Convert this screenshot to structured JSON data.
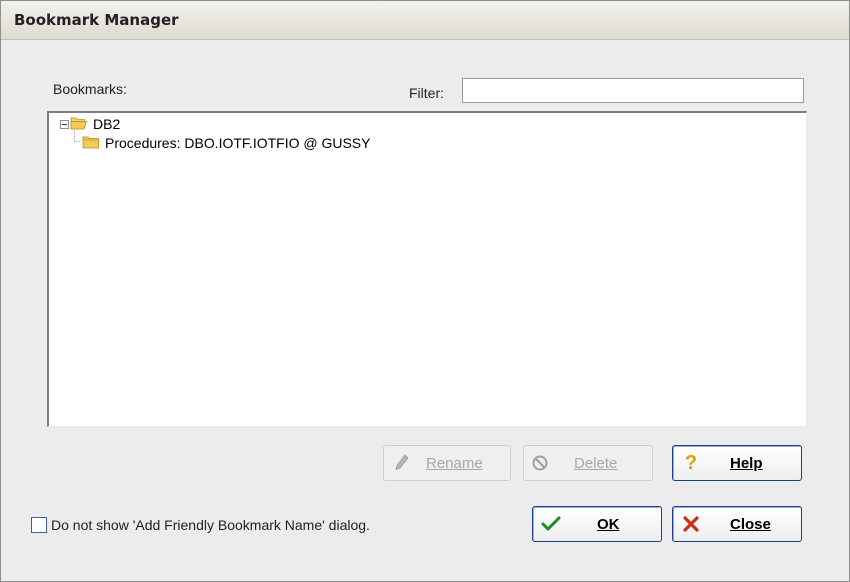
{
  "dialog": {
    "title": "Bookmark Manager"
  },
  "bookmarks_label": "Bookmarks:",
  "filter": {
    "label": "Filter:",
    "value": "",
    "placeholder": ""
  },
  "tree": {
    "root": {
      "label": "DB2",
      "icon": "open-folder-icon",
      "expanded": true
    },
    "children": [
      {
        "label": "Procedures: DBO.IOTF.IOTFIO @ GUSSY",
        "icon": "folder-icon"
      }
    ]
  },
  "buttons": {
    "rename": {
      "label": "Rename",
      "icon": "pencil-icon",
      "enabled": false
    },
    "delete": {
      "label": "Delete",
      "icon": "no-entry-icon",
      "enabled": false
    },
    "help": {
      "label": "Help",
      "icon": "question-icon",
      "enabled": true
    },
    "ok": {
      "label": "OK",
      "icon": "check-icon",
      "enabled": true
    },
    "close": {
      "label": "Close",
      "icon": "x-icon",
      "enabled": true
    }
  },
  "checkbox": {
    "label": "Do not show 'Add Friendly Bookmark Name' dialog.",
    "checked": false
  },
  "colors": {
    "dialog_bg": "#ececec",
    "folder": "#f3c95a",
    "help_icon": "#e0a000",
    "ok_icon": "#1f8a1f",
    "close_icon": "#d02a10",
    "button_border": "#1a3e8c"
  }
}
